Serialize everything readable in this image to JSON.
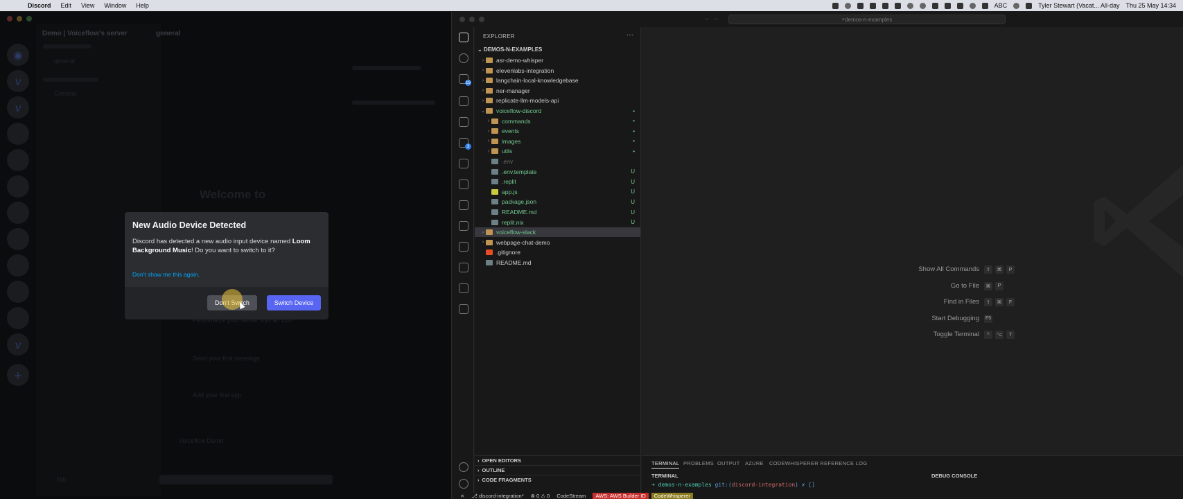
{
  "menubar": {
    "app": "Discord",
    "items": [
      "Edit",
      "View",
      "Window",
      "Help"
    ],
    "status_user": "Tyler Stewart (Vacat... All-day",
    "abc": "ABC",
    "clock": "Thu 25 May  14:34"
  },
  "discord": {
    "server_name": "Demo | Voiceflow's server",
    "channel": "general",
    "channel_list_item": "general",
    "voice_item": "General",
    "welcome": "Welcome to",
    "checklist": [
      "Personalize your server with an icon",
      "Send your first message",
      "Add your first app"
    ],
    "bottom_author": "Voiceflow Demo",
    "user_name": "Nik",
    "modal": {
      "title": "New Audio Device Detected",
      "body_prefix": "Discord has detected a new audio input device named",
      "device": "Loom Background Music",
      "body_suffix": "! Do you want to switch to it?",
      "link": "Don't show me this again.",
      "btn_cancel": "Don't Switch",
      "btn_confirm": "Switch Device"
    }
  },
  "vscode": {
    "search": "demos-n-examples",
    "explorer_title": "EXPLORER",
    "root": "DEMOS-N-EXAMPLES",
    "tree": [
      {
        "label": "asr-demo-whisper",
        "type": "folder",
        "depth": 0,
        "color": "#cccccc",
        "status": ""
      },
      {
        "label": "elevenlabs-integration",
        "type": "folder",
        "depth": 0,
        "color": "#cccccc",
        "status": ""
      },
      {
        "label": "langchain-local-knowledgebase",
        "type": "folder",
        "depth": 0,
        "color": "#cccccc",
        "status": ""
      },
      {
        "label": "ner-manager",
        "type": "folder",
        "depth": 0,
        "color": "#cccccc",
        "status": ""
      },
      {
        "label": "replicate-llm-models-api",
        "type": "folder",
        "depth": 0,
        "color": "#cccccc",
        "status": ""
      },
      {
        "label": "voiceflow-discord",
        "type": "folder-open",
        "depth": 0,
        "color": "#73c991",
        "status": "•"
      },
      {
        "label": "commands",
        "type": "folder",
        "depth": 1,
        "color": "#73c991",
        "status": "•"
      },
      {
        "label": "events",
        "type": "folder",
        "depth": 1,
        "color": "#73c991",
        "status": "•"
      },
      {
        "label": "images",
        "type": "folder",
        "depth": 1,
        "color": "#73c991",
        "status": "•"
      },
      {
        "label": "utils",
        "type": "folder",
        "depth": 1,
        "color": "#73c991",
        "status": "•"
      },
      {
        "label": ".env",
        "type": "file",
        "depth": 1,
        "color": "#6b6b6b",
        "status": ""
      },
      {
        "label": ".env.template",
        "type": "file",
        "depth": 1,
        "color": "#73c991",
        "status": "U"
      },
      {
        "label": ".replit",
        "type": "file",
        "depth": 1,
        "color": "#73c991",
        "status": "U"
      },
      {
        "label": "app.js",
        "type": "js",
        "depth": 1,
        "color": "#73c991",
        "status": "U"
      },
      {
        "label": "package.json",
        "type": "file",
        "depth": 1,
        "color": "#73c991",
        "status": "U"
      },
      {
        "label": "README.md",
        "type": "file",
        "depth": 1,
        "color": "#73c991",
        "status": "U"
      },
      {
        "label": "replit.nix",
        "type": "file",
        "depth": 1,
        "color": "#73c991",
        "status": "U"
      },
      {
        "label": "voiceflow-slack",
        "type": "folder",
        "depth": 0,
        "color": "#73c991",
        "status": "",
        "selected": true
      },
      {
        "label": "webpage-chat-demo",
        "type": "folder",
        "depth": 0,
        "color": "#cccccc",
        "status": ""
      },
      {
        "label": ".gitignore",
        "type": "git",
        "depth": 0,
        "color": "#cccccc",
        "status": ""
      },
      {
        "label": "README.md",
        "type": "file",
        "depth": 0,
        "color": "#cccccc",
        "status": ""
      }
    ],
    "sections": [
      "OPEN EDITORS",
      "OUTLINE",
      "CODE FRAGMENTS"
    ],
    "shortcuts": [
      {
        "label": "Show All Commands",
        "keys": [
          "⇧",
          "⌘",
          "P"
        ]
      },
      {
        "label": "Go to File",
        "keys": [
          "⌘",
          "P"
        ]
      },
      {
        "label": "Find in Files",
        "keys": [
          "⇧",
          "⌘",
          "F"
        ]
      },
      {
        "label": "Start Debugging",
        "keys": [
          "F5"
        ]
      },
      {
        "label": "Toggle Terminal",
        "keys": [
          "^",
          "⌥",
          "T"
        ]
      }
    ],
    "panel_tabs": [
      "TERMINAL",
      "PROBLEMS",
      "OUTPUT",
      "AZURE",
      "CODEWHISPERER REFERENCE LOG"
    ],
    "panel_sub_left": "TERMINAL",
    "panel_sub_right": "DEBUG CONSOLE",
    "terminal": {
      "arrow": "➜",
      "dir": "demos-n-examples",
      "git": "git:(",
      "branch": "discord-integration",
      "end": ") ✗ []"
    },
    "status": {
      "branch": "discord-integration*",
      "errors": "⊗ 0 ⚠ 0",
      "codestream": "CodeStream",
      "aws": "AWS: AWS Builder ID",
      "cw": "CodeWhisperer"
    },
    "badges": {
      "scm": "19",
      "ext": "3"
    }
  }
}
